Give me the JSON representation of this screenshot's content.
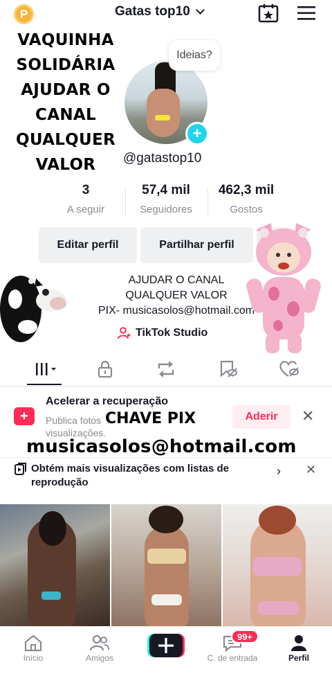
{
  "header": {
    "coin_label": "P",
    "account_name": "Gatas top10"
  },
  "overlay": {
    "left_lines": [
      "VAQUINHA",
      "SOLIDÁRIA",
      "AJUDAR O",
      "CANAL",
      "QUALQUER",
      "VALOR"
    ],
    "chave_label": "CHAVE PIX",
    "email": "musicasolos@hotmail.com"
  },
  "profile": {
    "ideas_bubble": "Ideias?",
    "username": "@gatastop10",
    "stats": [
      {
        "value": "3",
        "label": "A seguir"
      },
      {
        "value": "57,4 mil",
        "label": "Seguidores"
      },
      {
        "value": "462,3 mil",
        "label": "Gostos"
      }
    ],
    "edit_button": "Editar perfil",
    "share_button": "Partilhar perfil",
    "bio_lines": [
      "AJUDAR O CANAL",
      "QUALQUER VALOR",
      "PIX- musicasolos@hotmail.com"
    ],
    "studio_label": "TikTok Studio"
  },
  "notice": {
    "title": "Acelerar a recuperação",
    "desc": "Publica fotos ... visualizações.",
    "desc_line1": "Publica fotos",
    "desc_line2": "visualizações.",
    "join_button": "Aderir"
  },
  "playlist": {
    "text": "Obtém mais visualizações com listas de reprodução"
  },
  "nav": {
    "home": "Início",
    "friends": "Amigos",
    "inbox": "C. de entrada",
    "profile": "Perfil",
    "badge": "99+"
  },
  "colors": {
    "accent": "#fe2c55",
    "add_button": "#20d5ec",
    "coin": "#f6b43a"
  }
}
